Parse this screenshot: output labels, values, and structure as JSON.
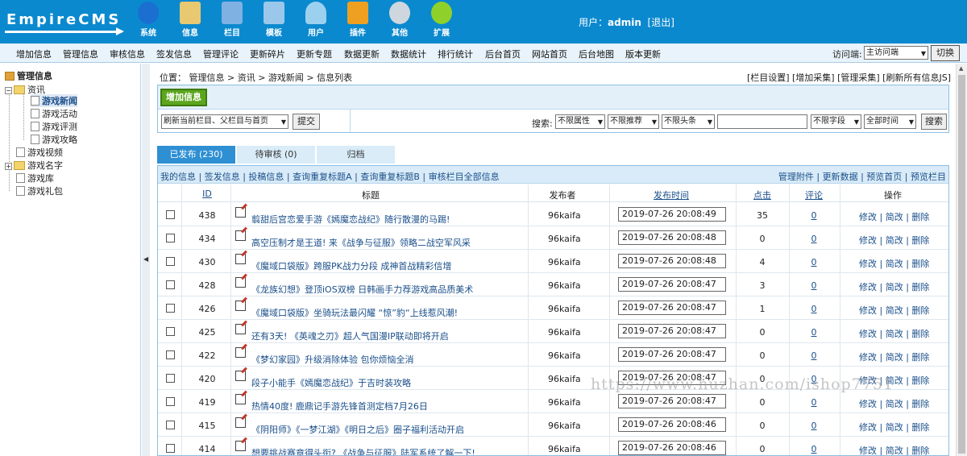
{
  "header": {
    "logo_text": "EmpireCMS",
    "nav": [
      {
        "label": "系统",
        "icon": "globe-icon",
        "color": "#1a6fd1"
      },
      {
        "label": "信息",
        "icon": "document-pencil-icon",
        "color": "#e8c870"
      },
      {
        "label": "栏目",
        "icon": "folder-icon",
        "color": "#7fb1e3"
      },
      {
        "label": "模板",
        "icon": "window-icon",
        "color": "#9ac7ea"
      },
      {
        "label": "用户",
        "icon": "user-icon",
        "color": "#9cd0ef"
      },
      {
        "label": "插件",
        "icon": "tools-icon",
        "color": "#f0a020"
      },
      {
        "label": "其他",
        "icon": "gear-icon",
        "color": "#cfd7de"
      },
      {
        "label": "扩展",
        "icon": "plus-icon",
        "color": "#8fd12a"
      }
    ],
    "user_label": "用户：",
    "user_name": "admin",
    "logout": "[退出]"
  },
  "subnav": {
    "items": [
      "增加信息",
      "管理信息",
      "审核信息",
      "签发信息",
      "管理评论",
      "更新碎片",
      "更新专题",
      "数据更新",
      "数据统计",
      "排行统计",
      "后台首页",
      "网站首页",
      "后台地图",
      "版本更新"
    ],
    "visit_label": "访问端:",
    "visit_value": "主访问端",
    "switch_label": "切换"
  },
  "sidebar": {
    "title": "管理信息",
    "nodes": {
      "zixun": "资讯",
      "news": "游戏新闻",
      "activity": "游戏活动",
      "review": "游戏评测",
      "guide": "游戏攻略",
      "video": "游戏视频",
      "names": "游戏名字",
      "library": "游戏库",
      "gift": "游戏礼包"
    }
  },
  "main": {
    "position": "位置： 管理信息 > 资讯 > 游戏新闻 > 信息列表",
    "top_links": "[栏目设置] [增加采集] [管理采集] [刷新所有信息JS]",
    "add_button": "增加信息",
    "refresh_select": "刷新当前栏目、父栏目与首页",
    "submit": "提交",
    "search_label": "搜索:",
    "filters": [
      "不限属性",
      "不限推荐",
      "不限头条"
    ],
    "field_select": "不限字段",
    "time_select": "全部时间",
    "search_button": "搜索",
    "tabs": [
      "已发布 (230)",
      "待审核 (0)",
      "归档"
    ],
    "action_left": "我的信息 | 签发信息 | 投稿信息 | 查询重复标题A | 查询重复标题B | 审核栏目全部信息",
    "action_right": "管理附件 | 更新数据 | 预览首页 | 预览栏目",
    "columns": {
      "id": "ID",
      "title": "标题",
      "publisher": "发布者",
      "time": "发布时间",
      "clicks": "点击",
      "comments": "评论",
      "ops": "操作"
    },
    "ops_text": "修改 | 简改 | 删除",
    "rows": [
      {
        "id": "438",
        "title": "翦甜后宫恋爱手游《嫣魔恋战纪》随行散漫的马踢!",
        "publisher": "96kaifa",
        "time": "2019-07-26 20:08:49",
        "clicks": "35",
        "comments": "0"
      },
      {
        "id": "434",
        "title": "高空压制才是王道! 来《战争与征服》领略二战空军风采",
        "publisher": "96kaifa",
        "time": "2019-07-26 20:08:48",
        "clicks": "0",
        "comments": "0"
      },
      {
        "id": "430",
        "title": "《魔域口袋版》跨服PK战力分段 成神首战精彩信增",
        "publisher": "96kaifa",
        "time": "2019-07-26 20:08:48",
        "clicks": "4",
        "comments": "0"
      },
      {
        "id": "428",
        "title": "《龙族幻想》登顶iOS双榜 日韩画手力荐游戏高品质美术",
        "publisher": "96kaifa",
        "time": "2019-07-26 20:08:47",
        "clicks": "3",
        "comments": "0"
      },
      {
        "id": "426",
        "title": "《魔域口袋版》坐骑玩法最闪耀 “惊”豹“上线惹风潮!",
        "publisher": "96kaifa",
        "time": "2019-07-26 20:08:47",
        "clicks": "1",
        "comments": "0"
      },
      {
        "id": "425",
        "title": "还有3天! 《英魂之刃》超人气国漫IP联动即将开启",
        "publisher": "96kaifa",
        "time": "2019-07-26 20:08:47",
        "clicks": "0",
        "comments": "0"
      },
      {
        "id": "422",
        "title": "《梦幻家园》升级消除体验 包你烦恼全消",
        "publisher": "96kaifa",
        "time": "2019-07-26 20:08:47",
        "clicks": "0",
        "comments": "0"
      },
      {
        "id": "420",
        "title": "段子小能手《嫣魔恋战纪》于吉时装攻略",
        "publisher": "96kaifa",
        "time": "2019-07-26 20:08:47",
        "clicks": "0",
        "comments": "0"
      },
      {
        "id": "419",
        "title": "热情40度! 鹿鼎记手游先锋首测定档7月26日",
        "publisher": "96kaifa",
        "time": "2019-07-26 20:08:47",
        "clicks": "0",
        "comments": "0"
      },
      {
        "id": "415",
        "title": "《阴阳师》《一梦江湖》《明日之后》圈子福利活动开启",
        "publisher": "96kaifa",
        "time": "2019-07-26 20:08:46",
        "clicks": "0",
        "comments": "0"
      },
      {
        "id": "414",
        "title": "想要挑战赛章得头衔? 《战争与征服》陆军系统了解一下!",
        "publisher": "96kaifa",
        "time": "2019-07-26 20:08:46",
        "clicks": "0",
        "comments": "0"
      }
    ]
  },
  "watermark": "https://www.huzhan.com/ishop7751"
}
